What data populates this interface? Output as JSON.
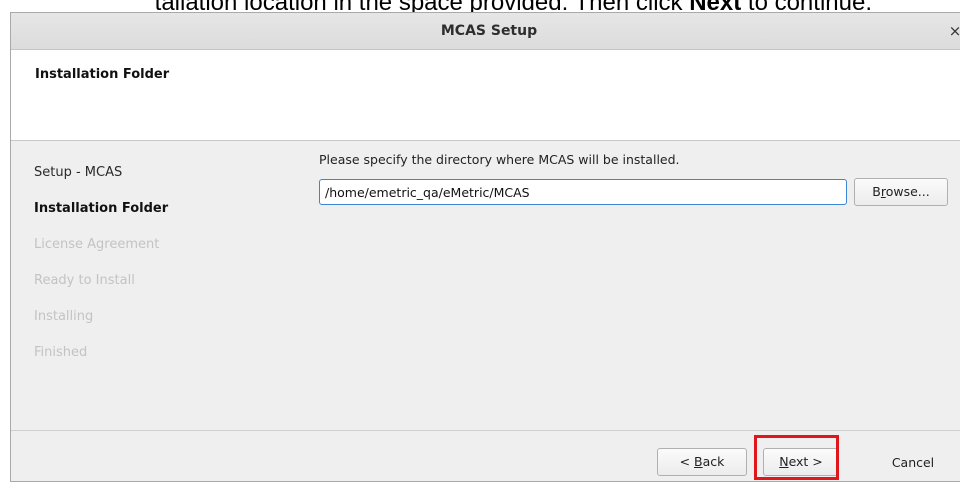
{
  "doc": {
    "instruction_prefix": "tallation location in the space provided. Then click ",
    "instruction_bold": "Next",
    "instruction_suffix": " to continue."
  },
  "window": {
    "title": "MCAS Setup",
    "close_glyph": "×"
  },
  "header": {
    "title": "Installation Folder"
  },
  "steps": [
    {
      "label": "Setup - MCAS",
      "state": "done"
    },
    {
      "label": "Installation Folder",
      "state": "current"
    },
    {
      "label": "License Agreement",
      "state": "pending"
    },
    {
      "label": "Ready to Install",
      "state": "pending"
    },
    {
      "label": "Installing",
      "state": "pending"
    },
    {
      "label": "Finished",
      "state": "pending"
    }
  ],
  "content": {
    "prompt": "Please specify the directory where MCAS will be installed.",
    "install_path": "/home/emetric_qa/eMetric/MCAS",
    "browse_prefix": "B",
    "browse_mnemonic": "r",
    "browse_suffix": "owse..."
  },
  "footer": {
    "back_prefix": "< ",
    "back_mnemonic": "B",
    "back_suffix": "ack",
    "next_mnemonic": "N",
    "next_suffix": "ext >",
    "cancel_label": "Cancel"
  },
  "colors": {
    "highlight": "#e0161d",
    "input_focus_border": "#3d86d6"
  }
}
